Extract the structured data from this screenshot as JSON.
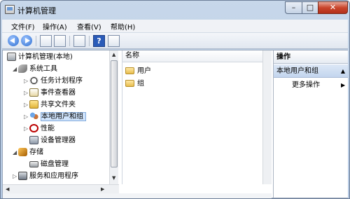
{
  "window": {
    "title": "计算机管理"
  },
  "menu": [
    "文件(F)",
    "操作(A)",
    "查看(V)",
    "帮助(H)"
  ],
  "tree": [
    {
      "label": "计算机管理(本地)",
      "icon": "computer-icon"
    },
    {
      "label": "系统工具",
      "icon": "tools-icon"
    },
    {
      "label": "任务计划程序",
      "icon": "clock-icon"
    },
    {
      "label": "事件查看器",
      "icon": "event-viewer-icon"
    },
    {
      "label": "共享文件夹",
      "icon": "shared-folder-icon"
    },
    {
      "label": "本地用户和组",
      "icon": "users-icon",
      "selected": true
    },
    {
      "label": "性能",
      "icon": "performance-icon"
    },
    {
      "label": "设备管理器",
      "icon": "device-manager-icon"
    },
    {
      "label": "存储",
      "icon": "storage-icon"
    },
    {
      "label": "磁盘管理",
      "icon": "disk-icon"
    },
    {
      "label": "服务和应用程序",
      "icon": "services-icon"
    }
  ],
  "list": {
    "column": "名称",
    "items": [
      "用户",
      "组"
    ]
  },
  "actions": {
    "header": "操作",
    "section": "本地用户和组",
    "item": "更多操作"
  },
  "colors": {
    "selection": "#cfe3fb",
    "titlebar": "#b4c8e2",
    "close": "#c9452c"
  }
}
